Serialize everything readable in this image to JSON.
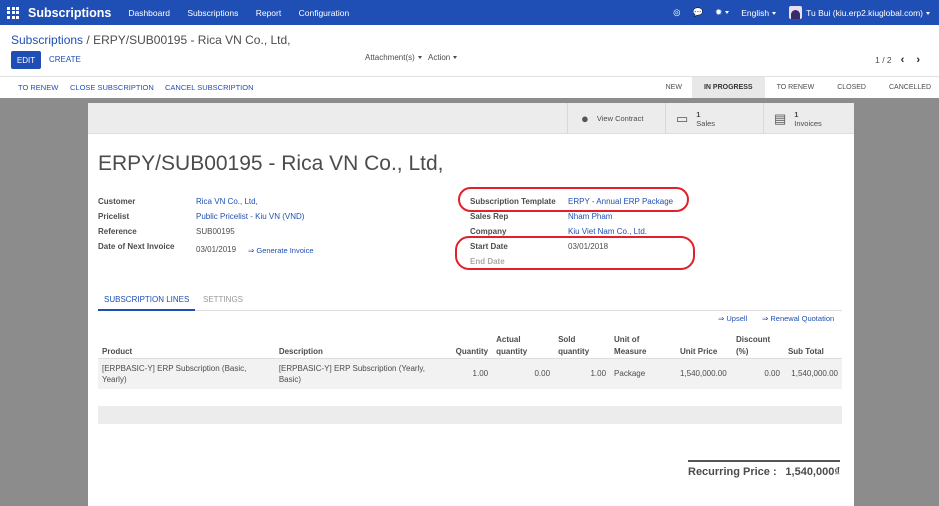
{
  "app": {
    "name": "Subscriptions",
    "menu": [
      "Dashboard",
      "Subscriptions",
      "Report",
      "Configuration"
    ],
    "language": "English",
    "user": "Tu Bui (kiu.erp2.kiuglobal.com)"
  },
  "breadcrumb": {
    "parent": "Subscriptions",
    "separator": "/",
    "current": "ERPY/SUB00195 - Rica VN Co., Ltd,"
  },
  "buttons": {
    "edit": "EDIT",
    "create": "CREATE",
    "attachments": "Attachment(s)",
    "action": "Action"
  },
  "pager": {
    "value": "1 / 2",
    "prev": "‹",
    "next": "›"
  },
  "status_actions": [
    "TO RENEW",
    "CLOSE SUBSCRIPTION",
    "CANCEL SUBSCRIPTION"
  ],
  "stages": [
    "NEW",
    "IN PROGRESS",
    "TO RENEW",
    "CLOSED",
    "CANCELLED"
  ],
  "active_stage": "IN PROGRESS",
  "smart_buttons": {
    "view_contract": "View Contract",
    "sales_count": "1",
    "sales_label": "Sales",
    "invoices_count": "1",
    "invoices_label": "Invoices"
  },
  "record": {
    "title": "ERPY/SUB00195 - Rica VN Co., Ltd,",
    "customer_label": "Customer",
    "customer": "Rica VN Co., Ltd,",
    "pricelist_label": "Pricelist",
    "pricelist": "Public Pricelist - Kiu VN (VND)",
    "reference_label": "Reference",
    "reference": "SUB00195",
    "next_invoice_label": "Date of Next Invoice",
    "next_invoice": "03/01/2019",
    "generate_invoice": "⇒ Generate Invoice",
    "template_label": "Subscription Template",
    "template": "ERPY - Annual ERP Package",
    "sales_rep_label": "Sales Rep",
    "sales_rep": "Nham Pham",
    "company_label": "Company",
    "company": "Kiu Viet Nam Co., Ltd.",
    "start_date_label": "Start Date",
    "start_date": "03/01/2018",
    "end_date_label": "End Date"
  },
  "tabs": [
    "SUBSCRIPTION LINES",
    "SETTINGS"
  ],
  "links": {
    "upsell": "⇒ Upsell",
    "renewal": "⇒ Renewal Quotation"
  },
  "table": {
    "headers": [
      "Product",
      "Description",
      "Quantity",
      "Actual quantity",
      "Sold quantity",
      "Unit of Measure",
      "Unit Price",
      "Discount (%)",
      "Sub Total"
    ],
    "rows": [
      [
        "[ERPBASIC-Y] ERP Subscription (Basic, Yearly)",
        "[ERPBASIC-Y] ERP Subscription (Yearly, Basic)",
        "1.00",
        "0.00",
        "1.00",
        "Package",
        "1,540,000.00",
        "0.00",
        "1,540,000.00"
      ]
    ]
  },
  "footer": {
    "recurring_label": "Recurring Price :",
    "recurring_value": "1,540,000₫"
  },
  "colors": {
    "brand": "#1f4fb5",
    "highlight": "#e0202a"
  }
}
